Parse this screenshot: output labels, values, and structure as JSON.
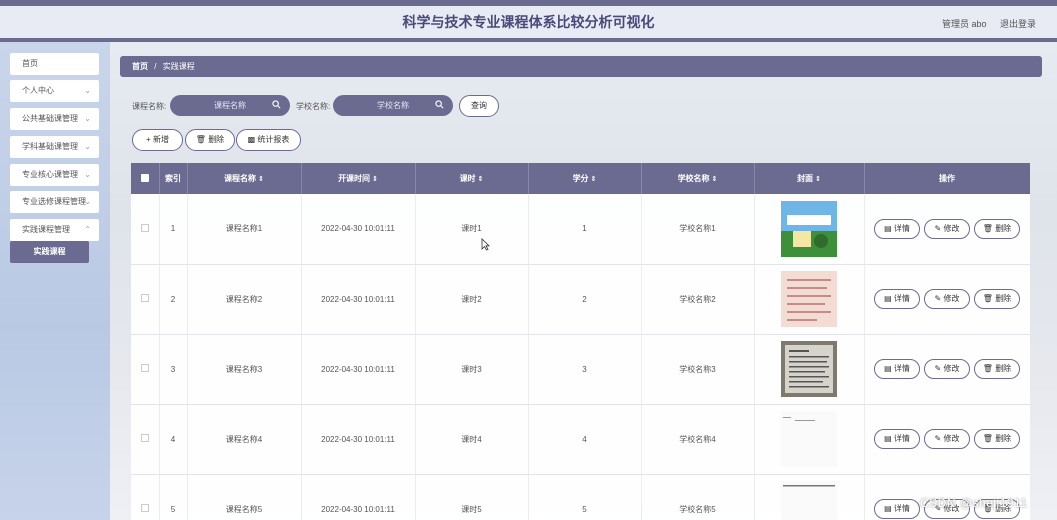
{
  "header": {
    "title": "科学与技术专业课程体系比较分析可视化",
    "user": "管理员 abo",
    "logout": "退出登录"
  },
  "sidebar": {
    "items": [
      {
        "label": "首页",
        "chevron": false
      },
      {
        "label": "个人中心",
        "chevron": true
      },
      {
        "label": "公共基础课管理",
        "chevron": true
      },
      {
        "label": "学科基础课管理",
        "chevron": true
      },
      {
        "label": "专业核心课管理",
        "chevron": true
      },
      {
        "label": "专业选修课程管理",
        "chevron": true
      },
      {
        "label": "实践课程管理",
        "chevron": true
      }
    ],
    "subitem": "实践课程"
  },
  "breadcrumb": {
    "home": "首页",
    "sep": "/",
    "current": "实践课程"
  },
  "search": {
    "course_label": "课程名称",
    "course_placeholder": "课程名称",
    "school_label": "学校名称",
    "school_placeholder": "学校名称",
    "query_button": "查询"
  },
  "actions": {
    "add": "+ 新增",
    "delete": "删除",
    "report": "统计报表"
  },
  "table": {
    "headers": {
      "index": "索引",
      "name": "课程名称",
      "time": "开课时间",
      "hours": "课时",
      "credit": "学分",
      "school": "学校名称",
      "cover": "封面",
      "ops": "操作"
    },
    "op_labels": {
      "detail": "详情",
      "edit": "修改",
      "delete": "删除"
    },
    "rows": [
      {
        "index": "1",
        "name": "课程名称1",
        "time": "2022-04-30 10:01:11",
        "hours": "课时1",
        "credit": "1",
        "school": "学校名称1"
      },
      {
        "index": "2",
        "name": "课程名称2",
        "time": "2022-04-30 10:01:11",
        "hours": "课时2",
        "credit": "2",
        "school": "学校名称2"
      },
      {
        "index": "3",
        "name": "课程名称3",
        "time": "2022-04-30 10:01:11",
        "hours": "课时3",
        "credit": "3",
        "school": "学校名称3"
      },
      {
        "index": "4",
        "name": "课程名称4",
        "time": "2022-04-30 10:01:11",
        "hours": "课时4",
        "credit": "4",
        "school": "学校名称4"
      },
      {
        "index": "5",
        "name": "课程名称5",
        "time": "2022-04-30 10:01:11",
        "hours": "课时5",
        "credit": "5",
        "school": "学校名称5"
      }
    ]
  },
  "watermark": "CSDN @shejj1911",
  "colors": {
    "accent": "#6b6b92",
    "title": "#4a4a78"
  }
}
